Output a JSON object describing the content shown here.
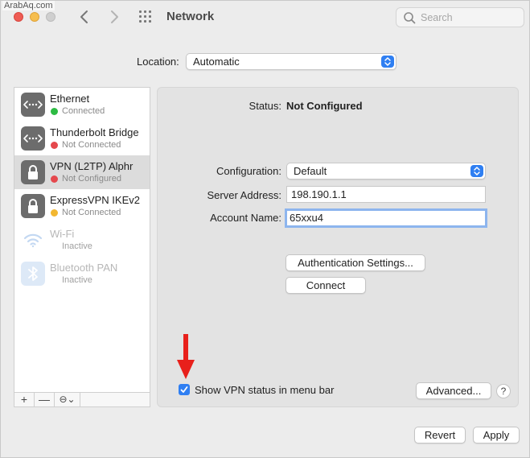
{
  "watermark": "ArabAq.com",
  "window": {
    "title": "Network"
  },
  "toolbar": {
    "search_placeholder": "Search"
  },
  "location": {
    "label": "Location:",
    "value": "Automatic"
  },
  "services": [
    {
      "name": "Ethernet",
      "status": "Connected",
      "status_color": "#2dbb43",
      "icon": "ethernet-icon"
    },
    {
      "name": "Thunderbolt Bridge",
      "status": "Not Connected",
      "status_color": "#e5484d",
      "icon": "ethernet-icon"
    },
    {
      "name": "VPN (L2TP) Alphr",
      "status": "Not Configured",
      "status_color": "#e5484d",
      "icon": "lock-icon",
      "selected": true
    },
    {
      "name": "ExpressVPN IKEv2",
      "status": "Not Connected",
      "status_color": "#f2b731",
      "icon": "lock-icon"
    },
    {
      "name": "Wi-Fi",
      "status": "Inactive",
      "icon": "wifi-icon"
    },
    {
      "name": "Bluetooth PAN",
      "status": "Inactive",
      "icon": "bluetooth-icon"
    }
  ],
  "sidebar_toolbar": {
    "add": "+",
    "remove": "—",
    "action": "⊖⌄"
  },
  "detail": {
    "status_label": "Status:",
    "status_value": "Not Configured",
    "configuration_label": "Configuration:",
    "configuration_value": "Default",
    "server_label": "Server Address:",
    "server_value": "198.190.1.1",
    "account_label": "Account Name:",
    "account_value": "65xxu4",
    "auth_button": "Authentication Settings...",
    "connect_button": "Connect",
    "show_status_label": "Show VPN status in menu bar",
    "show_status_checked": true,
    "advanced_button": "Advanced...",
    "help_button": "?"
  },
  "footer": {
    "revert": "Revert",
    "apply": "Apply"
  },
  "colors": {
    "accent": "#2f7ff2",
    "annotation_arrow": "#e8201b"
  }
}
